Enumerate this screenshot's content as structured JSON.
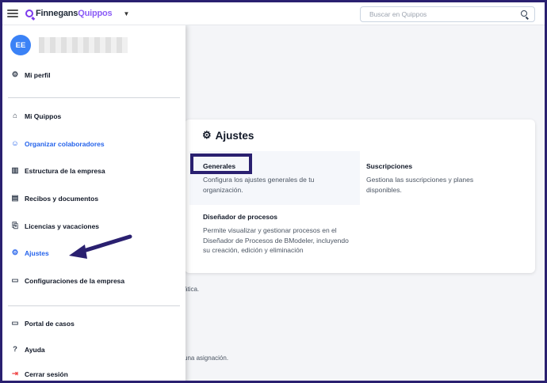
{
  "header": {
    "logo_part1": "Finnegans",
    "logo_part2": "Quippos",
    "search_placeholder": "Buscar en Quippos"
  },
  "user": {
    "initials": "EE"
  },
  "sidebar": {
    "profile": "Mi perfil",
    "items": [
      {
        "label": "Mi Quippos",
        "icon": "home-icon"
      },
      {
        "label": "Organizar colaboradores",
        "icon": "users-icon"
      },
      {
        "label": "Estructura de la empresa",
        "icon": "building-icon"
      },
      {
        "label": "Recibos y documentos",
        "icon": "document-icon"
      },
      {
        "label": "Licencias y vacaciones",
        "icon": "leave-icon"
      },
      {
        "label": "Ajustes",
        "icon": "gear-icon"
      },
      {
        "label": "Configuraciones de la empresa",
        "icon": "monitor-gear-icon"
      }
    ],
    "bottom": [
      {
        "label": "Portal de casos",
        "icon": "laptop-icon"
      },
      {
        "label": "Ayuda",
        "icon": "help-icon"
      },
      {
        "label": "Cerrar sesión",
        "icon": "logout-icon"
      }
    ]
  },
  "background": {
    "text1": "ática.",
    "text2": "una asignación."
  },
  "settings": {
    "title": "Ajustes",
    "options": [
      {
        "title": "Generales",
        "desc": "Configura los ajustes generales de tu organización."
      },
      {
        "title": "Suscripciones",
        "desc": "Gestiona las suscripciones y planes disponibles."
      },
      {
        "title": "Diseñador de procesos",
        "desc": "Permite visualizar y gestionar procesos en el Diseñador de Procesos de BModeler, incluyendo su creación, edición y eliminación"
      }
    ]
  },
  "colors": {
    "accent": "#2563eb",
    "brand": "#8b5cf6",
    "annotation": "#2a2070"
  }
}
